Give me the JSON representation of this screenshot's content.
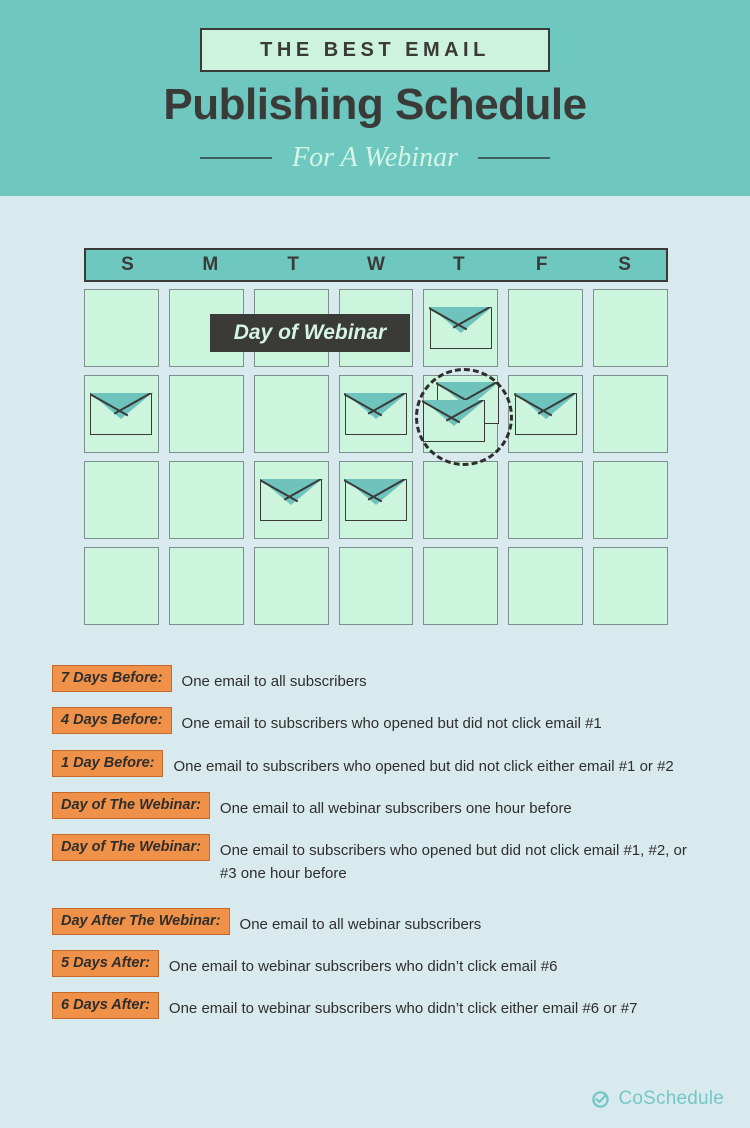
{
  "header": {
    "eyebrow": "THE BEST EMAIL",
    "title": "Publishing Schedule",
    "subtitle": "For A Webinar"
  },
  "calendar": {
    "day_headers": [
      "S",
      "M",
      "T",
      "W",
      "T",
      "F",
      "S"
    ],
    "webinar_label": "Day of Webinar",
    "rows": [
      {
        "envelopes": [
          false,
          false,
          false,
          false,
          true,
          false,
          false
        ],
        "double_index": -1
      },
      {
        "envelopes": [
          true,
          false,
          false,
          true,
          true,
          true,
          false
        ],
        "double_index": 4
      },
      {
        "envelopes": [
          false,
          false,
          true,
          true,
          false,
          false,
          false
        ],
        "double_index": -1
      },
      {
        "envelopes": [
          false,
          false,
          false,
          false,
          false,
          false,
          false
        ],
        "double_index": -1
      }
    ]
  },
  "legend": {
    "items": [
      {
        "badge": "7 Days Before:",
        "desc": "One email to all subscribers"
      },
      {
        "badge": "4 Days Before:",
        "desc": "One email to subscribers who opened but did not click email #1"
      },
      {
        "badge": "1 Day Before:",
        "desc": "One email to subscribers who opened but did not click either email #1 or #2"
      },
      {
        "badge": "Day of The Webinar:",
        "desc": "One email to all webinar subscribers one hour before"
      },
      {
        "badge": "Day of The Webinar:",
        "desc": "One email to subscribers who opened but did not click email #1, #2, or #3 one hour before"
      },
      {
        "badge": "Day After The Webinar:",
        "desc": "One email to all webinar subscribers"
      },
      {
        "badge": "5 Days After:",
        "desc": "One email to webinar subscribers who didn’t click email #6"
      },
      {
        "badge": "6 Days After:",
        "desc": "One email to webinar subscribers who didn’t click either email #6 or #7"
      }
    ]
  },
  "footer": {
    "brand": "CoSchedule"
  },
  "colors": {
    "page_background": "#d9eaee",
    "header_teal": "#6ec8c0",
    "cell_mint": "#cdf5de",
    "badge_orange": "#f0914a",
    "badge_border": "#c46a2c",
    "dark": "#3a3a38",
    "logo_teal": "#74c7c6"
  }
}
